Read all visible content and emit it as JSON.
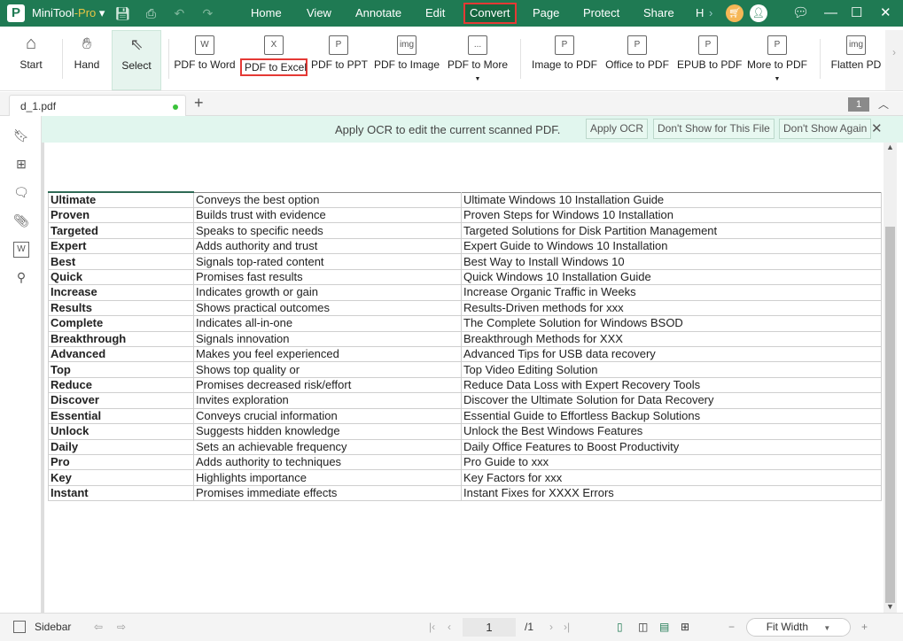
{
  "app": {
    "name": "MiniTool",
    "name_suffix": "-Pro"
  },
  "menu": [
    "Home",
    "View",
    "Annotate",
    "Edit",
    "Convert",
    "Page",
    "Protect",
    "Share",
    "H"
  ],
  "active_menu": "Convert",
  "ribbon": [
    {
      "label": "Start",
      "icon": "home-icon"
    },
    {
      "label": "Hand",
      "icon": "hand-icon"
    },
    {
      "label": "Select",
      "icon": "cursor-icon"
    },
    {
      "label": "PDF to Word",
      "icon": "W"
    },
    {
      "label": "PDF to Excel",
      "icon": "X"
    },
    {
      "label": "PDF to PPT",
      "icon": "P"
    },
    {
      "label": "PDF to Image",
      "icon": "img"
    },
    {
      "label": "PDF to More",
      "icon": "..."
    },
    {
      "label": "Image to PDF",
      "icon": "P"
    },
    {
      "label": "Office to PDF",
      "icon": "P"
    },
    {
      "label": "EPUB to PDF",
      "icon": "P"
    },
    {
      "label": "More to PDF",
      "icon": "P"
    },
    {
      "label": "Flatten PD",
      "icon": "img"
    }
  ],
  "tab": {
    "name": "d_1.pdf",
    "page_badge": "1"
  },
  "ocr": {
    "message": "Apply OCR to edit the current scanned PDF.",
    "apply": "Apply OCR",
    "dont_show_file": "Don't Show for This File",
    "dont_show_again": "Don't Show Again"
  },
  "table": [
    [
      "Ultimate",
      "Conveys the best option",
      "Ultimate Windows 10 Installation Guide"
    ],
    [
      "Proven",
      "Builds trust with evidence",
      "Proven Steps for Windows 10 Installation"
    ],
    [
      "Targeted",
      "Speaks to specific needs",
      "Targeted Solutions for Disk Partition Management"
    ],
    [
      "Expert",
      "Adds authority and trust",
      "Expert Guide to Windows 10 Installation"
    ],
    [
      "Best",
      "Signals top-rated content",
      "Best Way to Install Windows 10"
    ],
    [
      "Quick",
      "Promises fast results",
      "Quick Windows 10 Installation Guide"
    ],
    [
      "Increase",
      "Indicates growth or gain",
      "Increase Organic Traffic in Weeks"
    ],
    [
      "Results",
      "Shows practical outcomes",
      "Results-Driven methods for xxx"
    ],
    [
      "Complete",
      "Indicates all-in-one",
      "The Complete Solution for Windows BSOD"
    ],
    [
      "Breakthrough",
      "Signals innovation",
      "Breakthrough Methods for XXX"
    ],
    [
      "Advanced",
      "Makes you feel experienced",
      "Advanced Tips for USB data recovery"
    ],
    [
      "Top",
      "Shows top quality or",
      "Top Video Editing Solution"
    ],
    [
      "Reduce",
      "Promises decreased risk/effort",
      "Reduce Data Loss with Expert Recovery Tools"
    ],
    [
      "Discover",
      "Invites exploration",
      "Discover the Ultimate Solution for Data Recovery"
    ],
    [
      "Essential",
      "Conveys crucial information",
      "Essential Guide to Effortless Backup Solutions"
    ],
    [
      "Unlock",
      "Suggests hidden knowledge",
      "Unlock the Best Windows Features"
    ],
    [
      "Daily",
      "Sets an achievable frequency",
      "Daily Office Features to Boost Productivity"
    ],
    [
      "Pro",
      "Adds authority to techniques",
      "Pro Guide to xxx"
    ],
    [
      "Key",
      "Highlights importance",
      "Key Factors for xxx"
    ],
    [
      "Instant",
      "Promises immediate effects",
      "Instant Fixes for XXXX Errors"
    ]
  ],
  "status": {
    "sidebar": "Sidebar",
    "page": "1",
    "total": "/1",
    "zoom": "Fit Width"
  },
  "colors": {
    "brand": "#1f7a53",
    "highlight": "#e53935",
    "ocr_bar": "#e1f6ee"
  }
}
